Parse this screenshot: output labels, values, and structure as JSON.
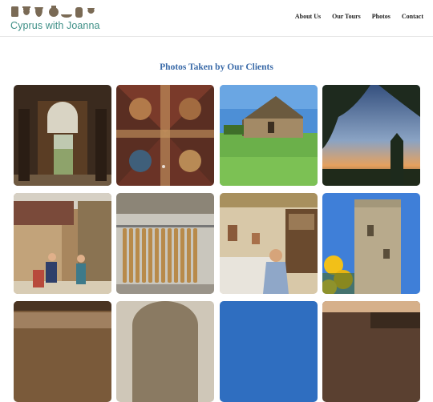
{
  "header": {
    "brand": "Cyprus with Joanna",
    "brand_color": "#3d8f86",
    "nav": [
      {
        "label": "About Us"
      },
      {
        "label": "Our Tours"
      },
      {
        "label": "Photos"
      },
      {
        "label": "Contact"
      }
    ]
  },
  "main": {
    "title": "Photos Taken by Our Clients",
    "title_color": "#3a6aa8"
  },
  "gallery": {
    "photos": [
      {
        "subject": "stone-archway-doorway"
      },
      {
        "subject": "painted-church-ceiling-frescoes"
      },
      {
        "subject": "stone-church-on-green-meadow"
      },
      {
        "subject": "pine-tree-sunset-sky"
      },
      {
        "subject": "village-street-with-tourists"
      },
      {
        "subject": "hanging-sweets-shed"
      },
      {
        "subject": "woman-in-craft-workshop"
      },
      {
        "subject": "stone-tower-with-yellow-flowers"
      },
      {
        "subject": "restaurant-interior"
      },
      {
        "subject": "stone-arch-cellar"
      },
      {
        "subject": "blue-sky"
      },
      {
        "subject": "wine-cellar-barrels"
      }
    ]
  }
}
